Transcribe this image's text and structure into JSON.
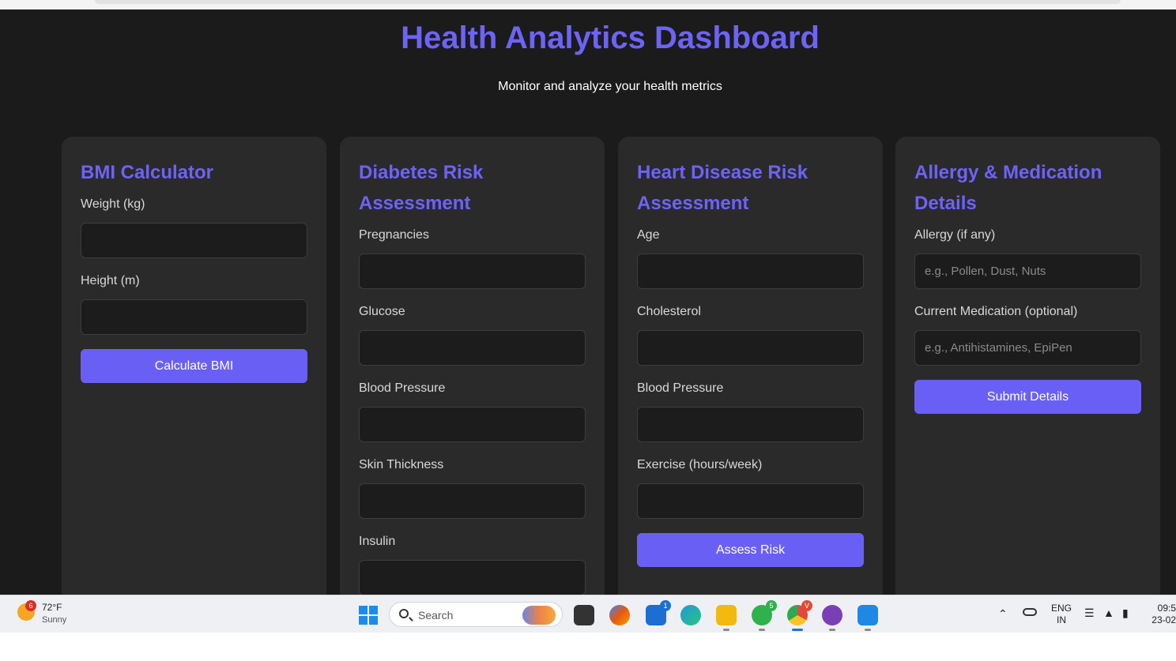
{
  "header": {
    "title": "Health Analytics Dashboard",
    "subtitle": "Monitor and analyze your health metrics"
  },
  "colors": {
    "accent": "#6d63f6",
    "button": "#6a5ff5",
    "background": "#1b1b1c",
    "card": "#2a2a2b"
  },
  "bmi": {
    "title": "BMI Calculator",
    "weight_label": "Weight (kg)",
    "weight_value": "",
    "height_label": "Height (m)",
    "height_value": "",
    "button": "Calculate BMI"
  },
  "diabetes": {
    "title": "Diabetes Risk Assessment",
    "pregnancies_label": "Pregnancies",
    "glucose_label": "Glucose",
    "bp_label": "Blood Pressure",
    "skin_label": "Skin Thickness",
    "insulin_label": "Insulin"
  },
  "heart": {
    "title": "Heart Disease Risk Assessment",
    "age_label": "Age",
    "cholesterol_label": "Cholesterol",
    "bp_label": "Blood Pressure",
    "exercise_label": "Exercise (hours/week)",
    "button": "Assess Risk"
  },
  "allergy": {
    "title": "Allergy & Medication Details",
    "allergy_label": "Allergy (if any)",
    "allergy_placeholder": "e.g., Pollen, Dust, Nuts",
    "medication_label": "Current Medication (optional)",
    "medication_placeholder": "e.g., Antihistamines, EpiPen",
    "button": "Submit Details"
  },
  "taskbar": {
    "weather_temp": "72°F",
    "weather_condition": "Sunny",
    "weather_badge": "6",
    "search_label": "Search",
    "language_top": "ENG",
    "language_bottom": "IN",
    "time": "09:5",
    "date": "23-02",
    "icons": [
      {
        "name": "start-icon"
      },
      {
        "name": "file-explorer-dark-icon",
        "color": "#333333"
      },
      {
        "name": "copilot-icon",
        "color": "#e8590c"
      },
      {
        "name": "todo-icon",
        "color": "#1c6fd1",
        "badge": "1"
      },
      {
        "name": "edge-icon",
        "color": "#1a9bd7"
      },
      {
        "name": "file-explorer-icon",
        "color": "#f2b90f"
      },
      {
        "name": "whatsapp-icon",
        "color": "#2fb14c",
        "badge": "5"
      },
      {
        "name": "chrome-icon",
        "color": "#e04a3a",
        "badge": "V"
      },
      {
        "name": "podcast-icon",
        "color": "#7b3fb5"
      },
      {
        "name": "vscode-icon",
        "color": "#1e88e5"
      }
    ]
  }
}
